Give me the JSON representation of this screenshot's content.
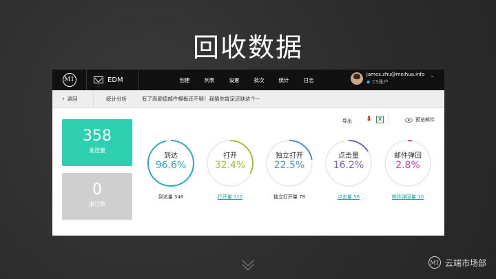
{
  "slide": {
    "title": "回收数据"
  },
  "topbar": {
    "logo_text": "M1",
    "product_name": "EDM",
    "nav": [
      "创建",
      "列表",
      "设置",
      "批次",
      "统计",
      "日志"
    ],
    "user_email": "james.zhu@meihua.info",
    "user_role": "CS账户"
  },
  "subbar": {
    "back_label": "返回",
    "section": "统计分析",
    "promo_text": "有了高颜值邮件模板还不够！我猜你肯定还缺这个~"
  },
  "cards": {
    "sent": {
      "value": "358",
      "label": "发送量"
    },
    "unsub": {
      "value": "0",
      "label": "退订数"
    }
  },
  "toolbar": {
    "export_label": "导出",
    "pdf_label": "PDF",
    "xls_label": "X",
    "preview_label": "预览邮件"
  },
  "stats": [
    {
      "label": "到达",
      "percent_text": "96.6%",
      "fraction": 0.966,
      "color": "#29a8c8",
      "caption": "到达量 346",
      "link": false
    },
    {
      "label": "打开",
      "percent_text": "32.4%",
      "fraction": 0.324,
      "color": "#9fc22d",
      "caption": "打开量 112",
      "link": true
    },
    {
      "label": "独立打开",
      "percent_text": "22.5%",
      "fraction": 0.225,
      "color": "#4a8fd8",
      "caption": "独立打开量 78",
      "link": false
    },
    {
      "label": "点击量",
      "percent_text": "16.2%",
      "fraction": 0.162,
      "color": "#7a5fc4",
      "caption": "点击量 56",
      "link": true
    },
    {
      "label": "邮件弹回",
      "percent_text": "2.8%",
      "fraction": 0.028,
      "color": "#d23a9e",
      "caption": "邮件弹回量 10",
      "link": true
    }
  ],
  "footer": {
    "brand_logo": "M1",
    "brand_name": "云端市场部"
  }
}
